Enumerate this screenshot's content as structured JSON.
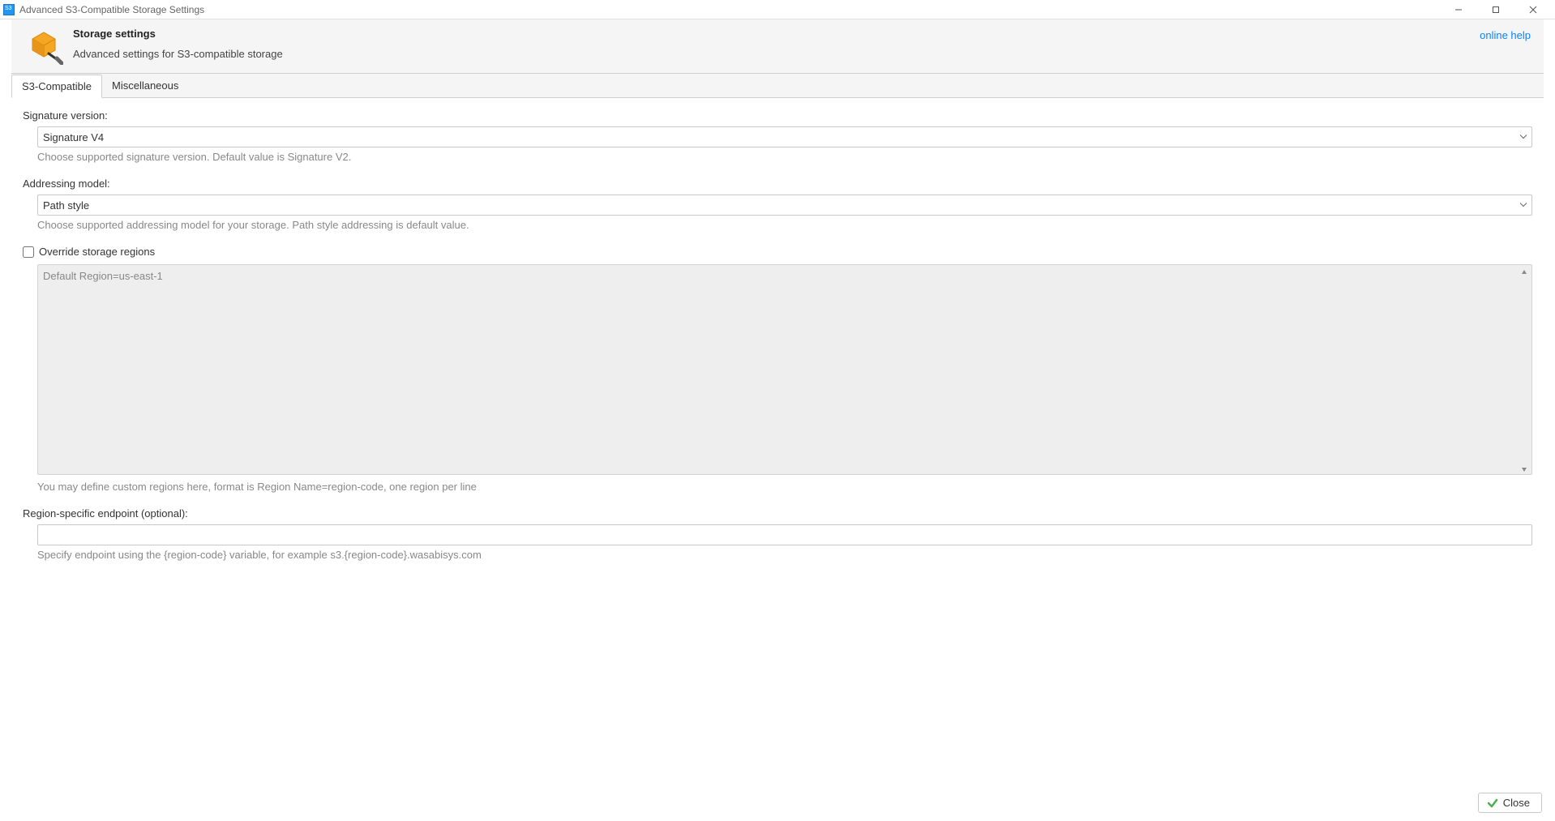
{
  "window": {
    "title": "Advanced S3-Compatible Storage Settings"
  },
  "header": {
    "title": "Storage settings",
    "subtitle": "Advanced settings for S3-compatible storage",
    "online_help": "online help"
  },
  "tabs": {
    "s3": "S3-Compatible",
    "misc": "Miscellaneous"
  },
  "form": {
    "signature_label": "Signature version:",
    "signature_value": "Signature V4",
    "signature_help": "Choose supported signature version. Default value is Signature V2.",
    "addressing_label": "Addressing model:",
    "addressing_value": "Path style",
    "addressing_help": "Choose supported addressing model for your storage. Path style addressing is default value.",
    "override_regions_label": "Override storage regions",
    "override_regions_checked": false,
    "regions_text": "Default Region=us-east-1",
    "regions_help": "You may define custom regions here, format is Region Name=region-code, one region per line",
    "endpoint_label": "Region-specific endpoint (optional):",
    "endpoint_value": "",
    "endpoint_help": "Specify endpoint using the {region-code} variable, for example s3.{region-code}.wasabisys.com"
  },
  "footer": {
    "close": "Close"
  }
}
